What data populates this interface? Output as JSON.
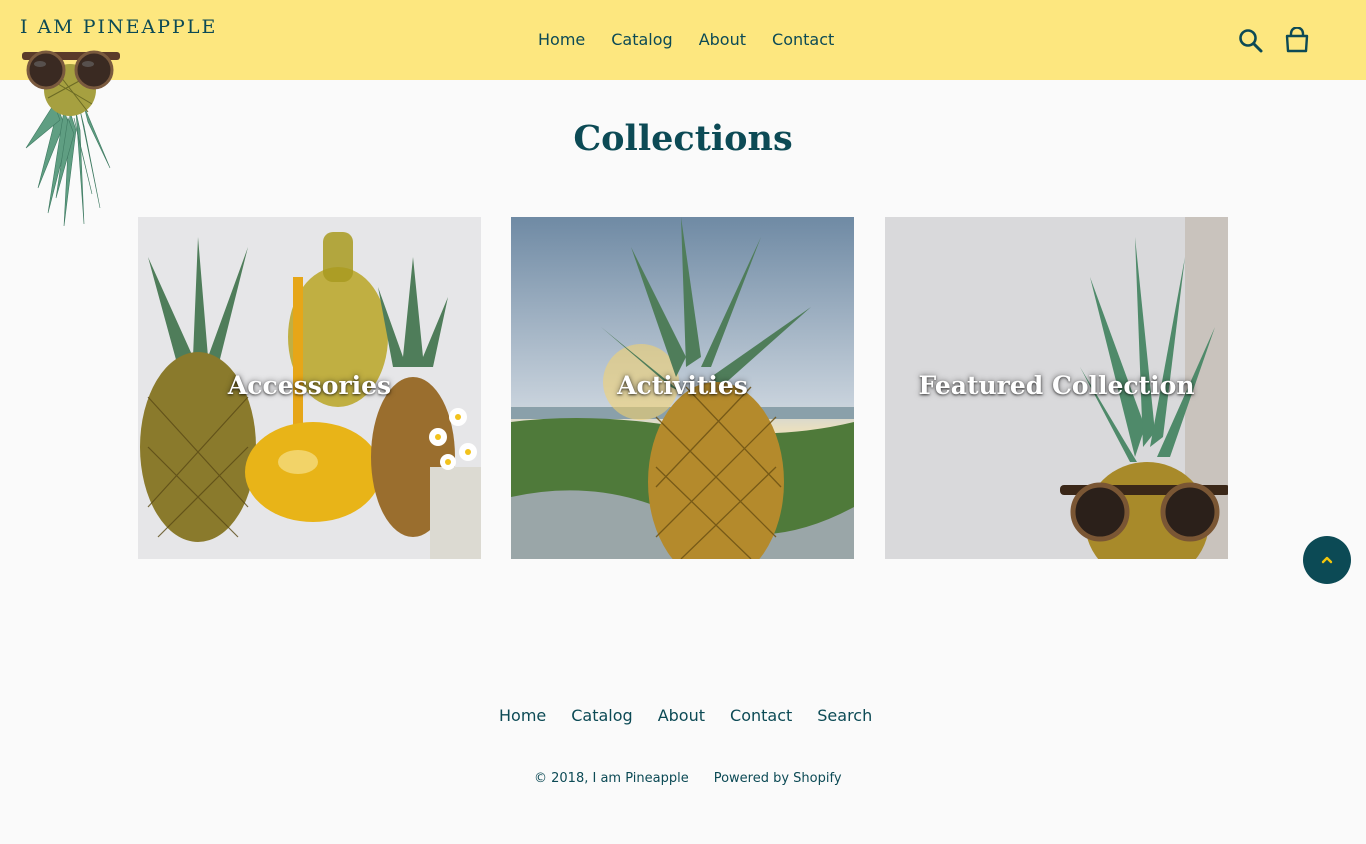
{
  "header": {
    "logo_text": "I AM PINEAPPLE",
    "nav": [
      "Home",
      "Catalog",
      "About",
      "Contact"
    ],
    "icons": [
      "search-icon",
      "cart-icon"
    ]
  },
  "main": {
    "title": "Collections",
    "collections": [
      {
        "label": "Accessories"
      },
      {
        "label": "Activities"
      },
      {
        "label": "Featured Collection"
      }
    ]
  },
  "back_to_top": {
    "icon": "chevron-up-icon"
  },
  "footer": {
    "nav": [
      "Home",
      "Catalog",
      "About",
      "Contact",
      "Search"
    ],
    "copyright": "© 2018, I am Pineapple",
    "powered": "Powered by Shopify"
  },
  "colors": {
    "header_bg": "#fde77f",
    "brand_text": "#0c4a55",
    "page_bg": "#fafafa",
    "accent_button": "#0c4a55",
    "chevron": "#f3c60c"
  }
}
